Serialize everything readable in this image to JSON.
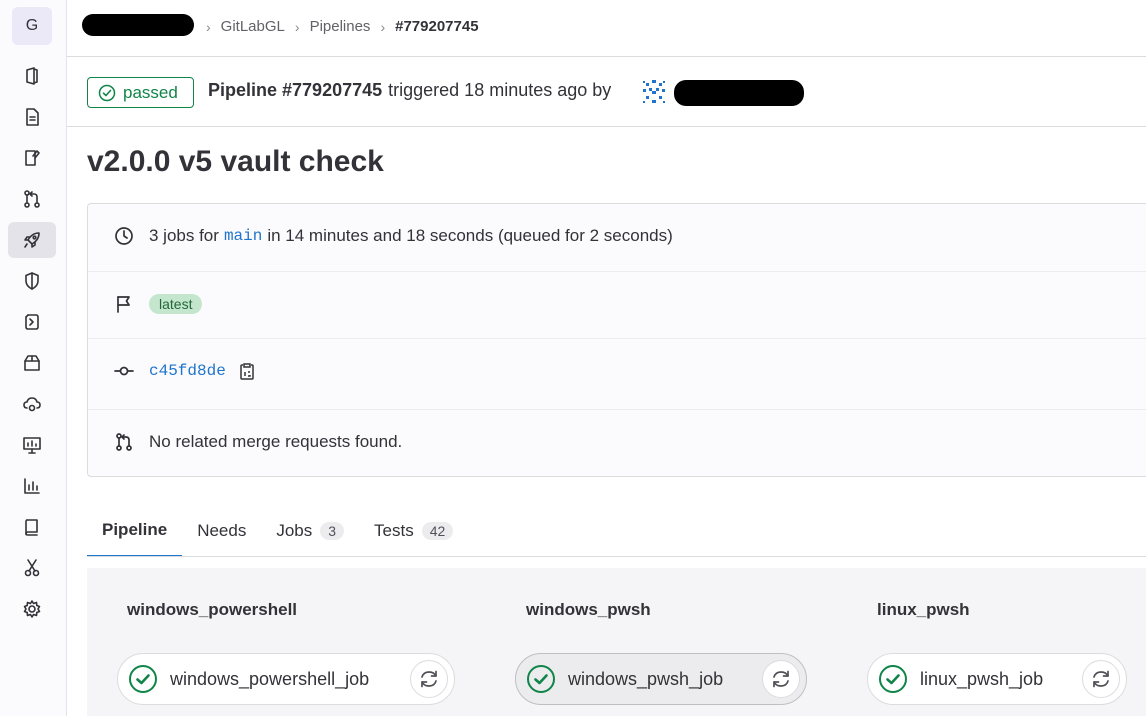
{
  "sidebar": {
    "logo_letter": "G",
    "items": [
      {
        "icon": "project-icon"
      },
      {
        "icon": "file-icon"
      },
      {
        "icon": "issues-icon"
      },
      {
        "icon": "merge-request-icon"
      },
      {
        "icon": "rocket-icon",
        "active": true
      },
      {
        "icon": "shield-icon"
      },
      {
        "icon": "deploy-icon"
      },
      {
        "icon": "package-icon"
      },
      {
        "icon": "cloud-gear-icon"
      },
      {
        "icon": "monitor-icon"
      },
      {
        "icon": "analytics-icon"
      },
      {
        "icon": "wiki-icon"
      },
      {
        "icon": "snippets-icon"
      },
      {
        "icon": "settings-icon"
      }
    ]
  },
  "breadcrumb": {
    "items": [
      "GitLabGL",
      "Pipelines",
      "#779207745"
    ],
    "separator": "›"
  },
  "pipeline": {
    "status": "passed",
    "label": "Pipeline #779207745",
    "triggered_text": "triggered 18 minutes ago by",
    "title": "v2.0.0 v5 vault check"
  },
  "info": {
    "jobs_prefix": "3 jobs for",
    "branch": "main",
    "jobs_suffix": "in 14 minutes and 18 seconds (queued for 2 seconds)",
    "tag": "latest",
    "commit": "c45fd8de",
    "merge_requests": "No related merge requests found."
  },
  "tabs": [
    {
      "label": "Pipeline",
      "active": true
    },
    {
      "label": "Needs"
    },
    {
      "label": "Jobs",
      "count": "3"
    },
    {
      "label": "Tests",
      "count": "42"
    }
  ],
  "graph": {
    "stages": [
      {
        "name": "windows_powershell",
        "job": "windows_powershell_job"
      },
      {
        "name": "windows_pwsh",
        "job": "windows_pwsh_job"
      },
      {
        "name": "linux_pwsh",
        "job": "linux_pwsh_job"
      }
    ]
  },
  "colors": {
    "success": "#108548",
    "link": "#1f75cb",
    "label_bg": "#c3e6cd"
  }
}
